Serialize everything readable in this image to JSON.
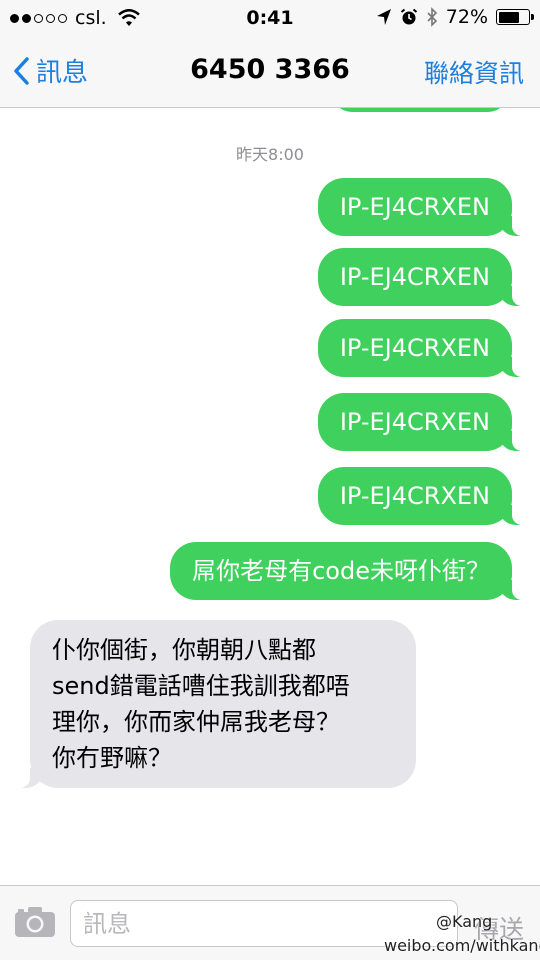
{
  "status_bar": {
    "carrier": "csl.",
    "signal_bars_filled": 2,
    "signal_bars_total": 5,
    "time": "0:41",
    "battery_percent": "72%",
    "battery_level": 0.72
  },
  "nav": {
    "back_label": "訊息",
    "title": "6450 3366",
    "contact_label": "聯絡資訊"
  },
  "thread": {
    "timestamp": "昨天8:00",
    "messages": [
      {
        "direction": "out",
        "text": "IP-EJ4CRXEN"
      },
      {
        "direction": "out",
        "text": "IP-EJ4CRXEN"
      },
      {
        "direction": "out",
        "text": "IP-EJ4CRXEN"
      },
      {
        "direction": "out",
        "text": "IP-EJ4CRXEN"
      },
      {
        "direction": "out",
        "text": "IP-EJ4CRXEN"
      },
      {
        "direction": "out",
        "text": "屌你老母有code未呀仆街？"
      },
      {
        "direction": "in",
        "lines": [
          "仆你個街，你朝朝八點都",
          "send錯電話嘈住我訓我都唔",
          "理你，你而家仲屌我老母？",
          "你冇野嘛？"
        ]
      }
    ]
  },
  "composer": {
    "placeholder": "訊息",
    "send_label": "傳送"
  },
  "watermark": {
    "handle": "@Kang",
    "site": "weibo.com/withkang"
  },
  "colors": {
    "accent": "#1d7fe0",
    "outgoing_bubble": "#3fd05d",
    "incoming_bubble": "#e5e5ea"
  }
}
